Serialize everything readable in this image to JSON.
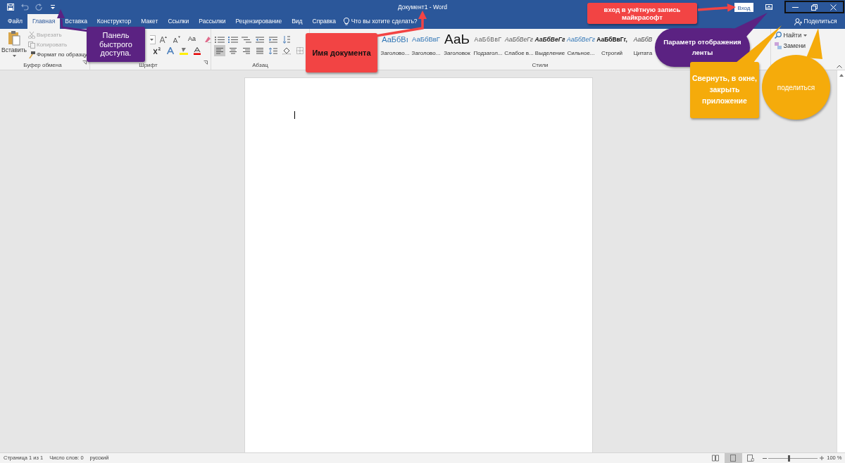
{
  "title_bar": {
    "title": "Документ1 - Word",
    "sign_in": "Вход"
  },
  "tabs": [
    {
      "label": "Файл",
      "selected": false
    },
    {
      "label": "Главная",
      "selected": true
    },
    {
      "label": "Вставка",
      "selected": false
    },
    {
      "label": "Конструктор",
      "selected": false
    },
    {
      "label": "Макет",
      "selected": false
    },
    {
      "label": "Ссылки",
      "selected": false
    },
    {
      "label": "Рассылки",
      "selected": false
    },
    {
      "label": "Рецензирование",
      "selected": false
    },
    {
      "label": "Вид",
      "selected": false
    },
    {
      "label": "Справка",
      "selected": false
    }
  ],
  "tell_me": "Что вы хотите сделать?",
  "share": "Поделиться",
  "ribbon": {
    "clipboard": {
      "label": "Буфер обмена",
      "paste": "Вставить",
      "items": [
        {
          "label": "Вырезать",
          "disabled": true
        },
        {
          "label": "Копировать",
          "disabled": true
        },
        {
          "label": "Формат по образцу",
          "disabled": false
        }
      ]
    },
    "font": {
      "label": "Шрифт",
      "case_button": "Аа"
    },
    "paragraph": {
      "label": "Абзац",
      "alignments": [
        {
          "kind": "left",
          "selected": true
        },
        {
          "kind": "center",
          "selected": false
        },
        {
          "kind": "right",
          "selected": false
        },
        {
          "kind": "justify",
          "selected": false
        }
      ]
    },
    "styles": {
      "label": "Стили",
      "items": [
        {
          "sample": "АаБбВı",
          "name": "Заголово...",
          "kind": "heading1"
        },
        {
          "sample": "АаБбВвГ",
          "name": "Заголово...",
          "kind": "heading2"
        },
        {
          "sample": "АаЬ",
          "name": "Заголовок",
          "kind": "title"
        },
        {
          "sample": "АаБбВвГ",
          "name": "Подзагол...",
          "kind": "subtitle"
        },
        {
          "sample": "АаБбВеГг",
          "name": "Слабое в...",
          "kind": "subtle"
        },
        {
          "sample": "АаБбВеГг",
          "name": "Выделение",
          "kind": "emphasis"
        },
        {
          "sample": "АаБбВеГг",
          "name": "Сильное...",
          "kind": "intense"
        },
        {
          "sample": "АаБбВвГг,",
          "name": "Строгий",
          "kind": "strong"
        },
        {
          "sample": "АаБбВ",
          "name": "Цитата",
          "kind": "quote"
        }
      ]
    },
    "editing": {
      "find": "Найти",
      "replace": "Замени"
    }
  },
  "status_bar": {
    "page": "Страница 1 из 1",
    "words": "Число слов: 0",
    "language": "русский",
    "views": [
      {
        "kind": "read",
        "selected": false
      },
      {
        "kind": "print",
        "selected": true
      },
      {
        "kind": "web",
        "selected": false
      }
    ],
    "zoom": {
      "level": 0.4,
      "reading": "100 %"
    }
  },
  "annotations": [
    {
      "text": "Панель быстрого доступа.",
      "color": "#5b2282",
      "kind": "box"
    },
    {
      "text": "Имя документа",
      "color": "#f24444",
      "kind": "box"
    },
    {
      "text": "вход в учётную запись майкрасофт",
      "color": "#f24444",
      "kind": "box"
    },
    {
      "text": "Параметр отображения ленты",
      "color": "#5b2282",
      "kind": "pill"
    },
    {
      "text": "Свернуть, в окне, закрыть приложение",
      "color": "#f5ab0b",
      "kind": "box"
    },
    {
      "text": "поделиться",
      "color": "#f5ab0b",
      "kind": "circle"
    }
  ]
}
